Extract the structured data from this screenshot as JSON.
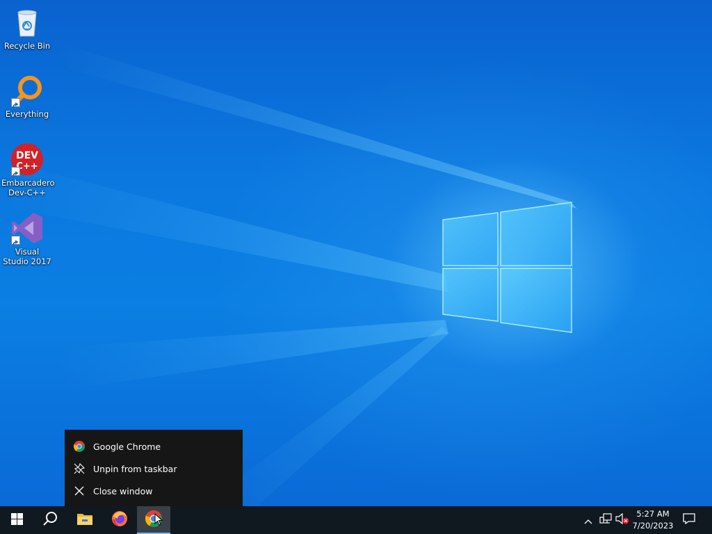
{
  "desktop": {
    "icons": [
      {
        "label": "Recycle Bin"
      },
      {
        "label": "Everything"
      },
      {
        "label": "Embarcadero Dev-C++",
        "badge_text": "DEV C++"
      },
      {
        "label": "Visual Studio 2017"
      }
    ]
  },
  "jumplist": {
    "items": [
      {
        "label": "Google Chrome",
        "icon": "chrome-icon"
      },
      {
        "label": "Unpin from taskbar",
        "icon": "unpin-icon"
      },
      {
        "label": "Close window",
        "icon": "close-icon"
      }
    ]
  },
  "taskbar": {
    "buttons": [
      "start-icon",
      "search-icon",
      "file-explorer-icon",
      "firefox-icon",
      "chrome-icon"
    ],
    "active": "chrome-icon",
    "clock": {
      "time": "5:27 AM",
      "date": "7/20/2023"
    }
  },
  "colors": {
    "taskbar": "#101820",
    "jumplist": "#161616",
    "accent": "#76b9ed"
  }
}
